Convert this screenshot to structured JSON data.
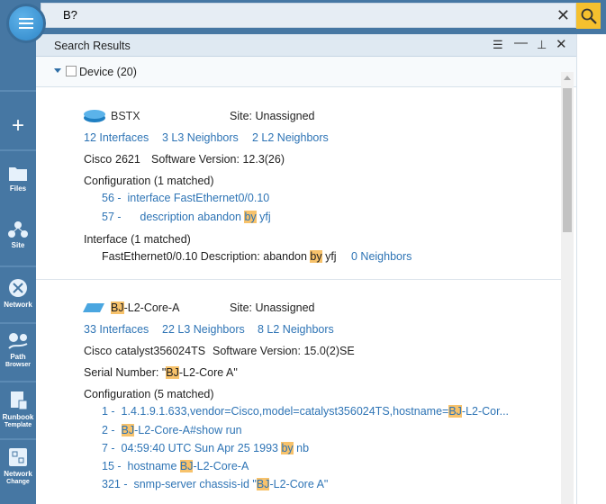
{
  "search": {
    "value": "B?"
  },
  "panel": {
    "title": "Search Results"
  },
  "group": {
    "label": "Device (20)"
  },
  "sidebar": {
    "items": [
      {
        "label": "Files"
      },
      {
        "label": "Site"
      },
      {
        "label": "Network"
      },
      {
        "label": "Path",
        "sub": "Browser"
      },
      {
        "label": "Runbook",
        "sub": "Template"
      },
      {
        "label": "Network",
        "sub": "Change"
      }
    ]
  },
  "devices": [
    {
      "name": "BSTX",
      "site": "Site: Unassigned",
      "interfaces": "12 Interfaces",
      "l3": "3 L3 Neighbors",
      "l2": "2 L2 Neighbors",
      "vendor": "Cisco",
      "model": "2621",
      "software": "Software Version: 12.3(26)",
      "config_title": "Configuration (1 matched)",
      "config": [
        {
          "num": "56 -",
          "parts": [
            "interface FastEthernet0/0.10"
          ]
        },
        {
          "num": "57 -",
          "parts": [
            "description abandon ",
            "by",
            " yfj"
          ]
        }
      ],
      "intf_title": "Interface (1 matched)",
      "intf": {
        "parts": [
          "FastEthernet0/0.10 Description: abandon ",
          "by",
          " yfj"
        ],
        "neighbors": "0 Neighbors"
      }
    },
    {
      "name_parts": [
        "BJ",
        "-L2-Core-A"
      ],
      "site": "Site: Unassigned",
      "interfaces": "33 Interfaces",
      "l3": "22 L3 Neighbors",
      "l2": "8 L2 Neighbors",
      "vendor": "Cisco",
      "model": "catalyst356024TS",
      "software": "Software Version: 15.0(2)SE",
      "serial_parts": [
        "Serial Number: \"",
        "BJ",
        "-L2-Core A\""
      ],
      "config_title": "Configuration (5 matched)",
      "config": [
        {
          "num": "1 -",
          "parts": [
            "1.4.1.9.1.633,vendor=Cisco,model=catalyst356024TS,hostname=",
            "BJ",
            "-L2-Cor..."
          ]
        },
        {
          "num": "2 -",
          "parts": [
            "",
            "BJ",
            "-L2-Core-A#show run"
          ]
        },
        {
          "num": "7 -",
          "parts": [
            "04:59:40 UTC Sun Apr 25 1993 ",
            "by",
            " nb"
          ]
        },
        {
          "num": "15 -",
          "parts": [
            "hostname ",
            "BJ",
            "-L2-Core-A"
          ]
        },
        {
          "num": "321 -",
          "parts": [
            "snmp-server chassis-id \"",
            "BJ",
            "-L2-Core A\""
          ]
        }
      ]
    }
  ]
}
